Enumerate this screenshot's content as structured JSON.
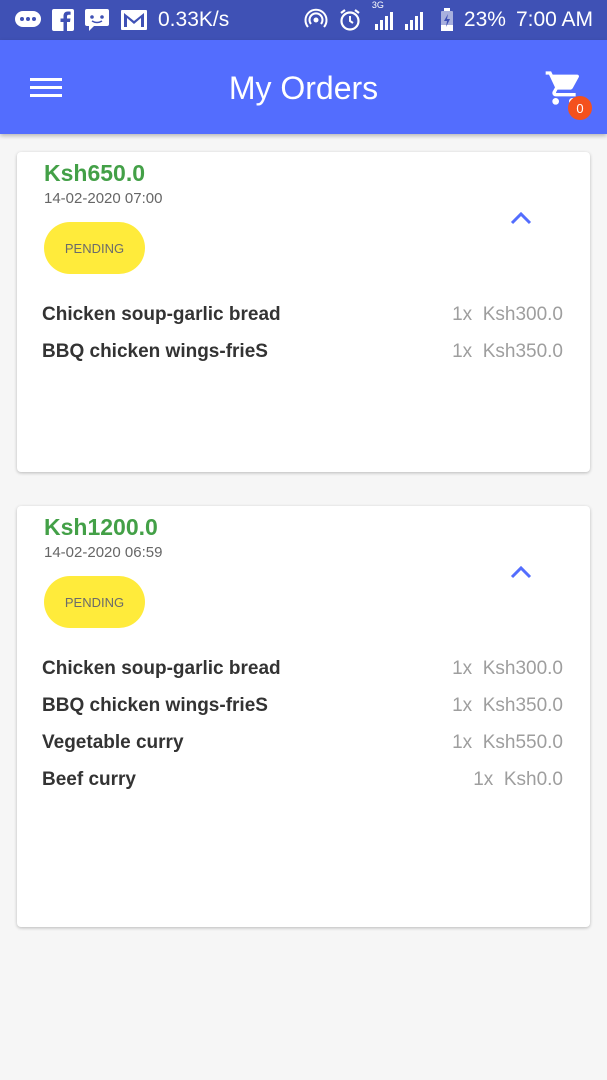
{
  "status_bar": {
    "net_speed": "0.33K/s",
    "network_label": "3G",
    "battery": "23%",
    "time": "7:00 AM",
    "icons": [
      "message-icon",
      "facebook-icon",
      "chat-icon",
      "gmail-icon",
      "hotspot-icon",
      "alarm-icon",
      "signal-icon",
      "battery-icon"
    ]
  },
  "app_bar": {
    "title": "My Orders",
    "menu_icon": "hamburger-menu-icon",
    "cart_icon": "shopping-cart-icon",
    "cart_count": "0"
  },
  "orders": [
    {
      "total": "Ksh650.0",
      "date": "14-02-2020 07:00",
      "status": "PENDING",
      "items": [
        {
          "name": "Chicken soup-garlic bread",
          "qty": "1x",
          "price": "Ksh300.0"
        },
        {
          "name": "BBQ chicken wings-frieS",
          "qty": "1x",
          "price": "Ksh350.0"
        }
      ]
    },
    {
      "total": "Ksh1200.0",
      "date": "14-02-2020 06:59",
      "status": "PENDING",
      "items": [
        {
          "name": "Chicken soup-garlic bread",
          "qty": "1x",
          "price": "Ksh300.0"
        },
        {
          "name": "BBQ chicken wings-frieS",
          "qty": "1x",
          "price": "Ksh350.0"
        },
        {
          "name": "Vegetable curry",
          "qty": "1x",
          "price": "Ksh550.0"
        },
        {
          "name": "Beef curry",
          "qty": "1x",
          "price": "Ksh0.0"
        }
      ]
    }
  ],
  "colors": {
    "status_bar": "#3f51b5",
    "app_bar": "#536dfe",
    "total_text": "#43a047",
    "pending_badge": "#ffeb3b",
    "cart_badge": "#f4511e",
    "chevron": "#536dfe"
  }
}
